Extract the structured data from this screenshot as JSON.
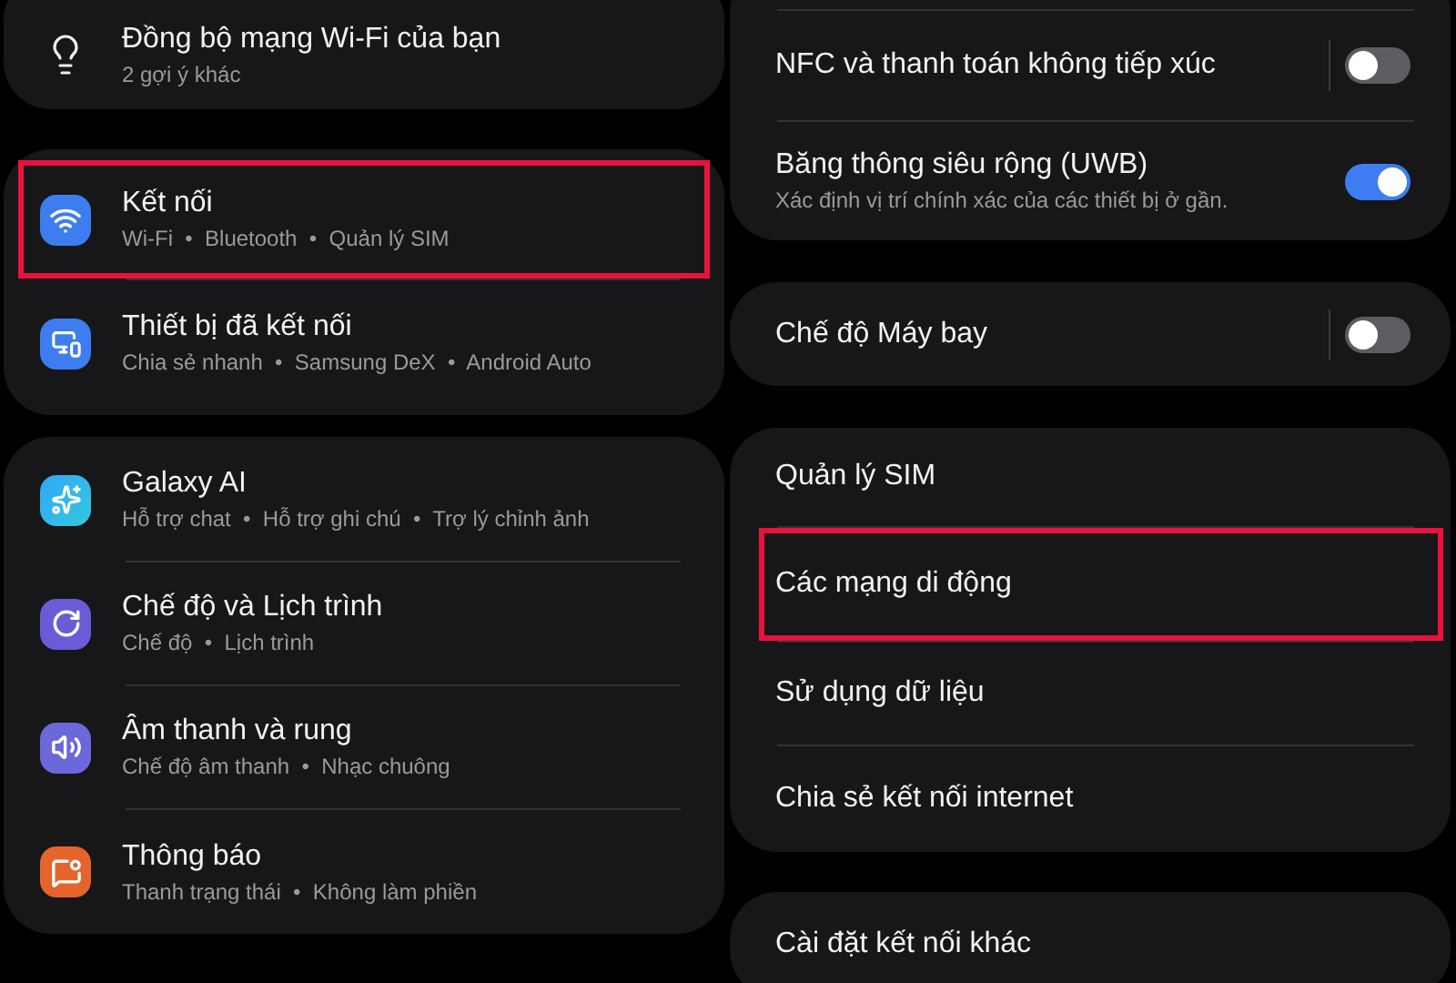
{
  "left_panel": {
    "cards": [
      {
        "items": [
          {
            "title": "Đồng bộ mạng Wi-Fi của bạn",
            "subtitle": "2 gợi ý khác",
            "highlighted": false
          }
        ]
      },
      {
        "items": [
          {
            "title": "Kết nối",
            "subtitle": "Wi-Fi  •  Bluetooth  •  Quản lý SIM",
            "highlighted": true
          },
          {
            "title": "Thiết bị đã kết nối",
            "subtitle": "Chia sẻ nhanh  •  Samsung DeX  •  Android Auto",
            "highlighted": false
          }
        ]
      },
      {
        "items": [
          {
            "title": "Galaxy AI",
            "subtitle": "Hỗ trợ chat  •  Hỗ trợ ghi chú  •  Trợ lý chỉnh ảnh",
            "highlighted": false
          },
          {
            "title": "Chế độ và Lịch trình",
            "subtitle": "Chế độ  •  Lịch trình",
            "highlighted": false
          },
          {
            "title": "Âm thanh và rung",
            "subtitle": "Chế độ âm thanh  •  Nhạc chuông",
            "highlighted": false
          },
          {
            "title": "Thông báo",
            "subtitle": "Thanh trạng thái  •  Không làm phiền",
            "highlighted": false
          }
        ]
      }
    ]
  },
  "right_panel": {
    "cards": [
      {
        "items": [
          {
            "kind": "toggle",
            "title": "NFC và thanh toán không tiếp xúc",
            "on": false,
            "highlighted": false
          },
          {
            "kind": "toggle",
            "title": "Băng thông siêu rộng (UWB)",
            "description": "Xác định vị trí chính xác của các thiết bị ở gần.",
            "on": true,
            "highlighted": false
          }
        ]
      },
      {
        "items": [
          {
            "kind": "toggle",
            "title": "Chế độ Máy bay",
            "on": false,
            "highlighted": false
          }
        ]
      },
      {
        "items": [
          {
            "kind": "link",
            "title": "Quản lý SIM",
            "highlighted": false
          },
          {
            "kind": "link",
            "title": "Các mạng di động",
            "highlighted": true
          },
          {
            "kind": "link",
            "title": "Sử dụng dữ liệu",
            "highlighted": false
          },
          {
            "kind": "link",
            "title": "Chia sẻ kết nối internet",
            "highlighted": false
          }
        ]
      },
      {
        "items": [
          {
            "kind": "link",
            "title": "Cài đặt kết nối khác",
            "highlighted": false
          }
        ]
      }
    ]
  }
}
